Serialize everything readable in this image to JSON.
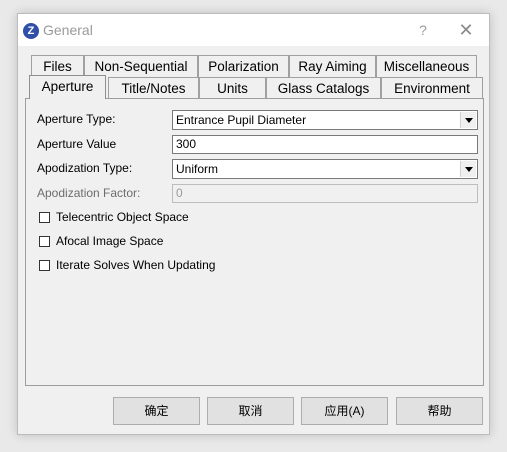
{
  "window": {
    "title": "General",
    "app_icon": "Z",
    "help_label": "?",
    "close_label": "✕"
  },
  "tabs_row1": [
    "Files",
    "Non-Sequential",
    "Polarization",
    "Ray Aiming",
    "Miscellaneous"
  ],
  "tabs_row2": [
    "Aperture",
    "Title/Notes",
    "Units",
    "Glass Catalogs",
    "Environment"
  ],
  "active_tab": "Aperture",
  "form": {
    "aperture_type_label": "Aperture Type:",
    "aperture_type_value": "Entrance Pupil Diameter",
    "aperture_value_label": "Aperture Value",
    "aperture_value": "300",
    "apodization_type_label": "Apodization Type:",
    "apodization_type_value": "Uniform",
    "apodization_factor_label": "Apodization Factor:",
    "apodization_factor_value": "0"
  },
  "checkboxes": [
    {
      "label": "Telecentric Object Space",
      "checked": false
    },
    {
      "label": "Afocal Image Space",
      "checked": false
    },
    {
      "label": "Iterate Solves When Updating",
      "checked": false
    }
  ],
  "buttons": {
    "ok": "确定",
    "cancel": "取消",
    "apply": "应用(A)",
    "help": "帮助"
  }
}
